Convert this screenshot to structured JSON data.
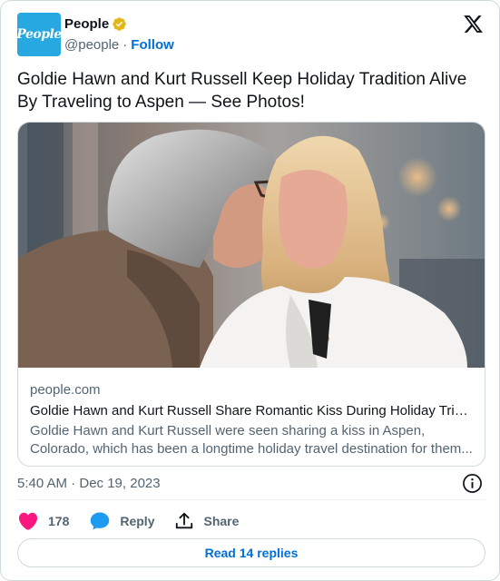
{
  "account": {
    "name": "People",
    "handle": "@people",
    "separator": "·",
    "follow_label": "Follow",
    "avatar_text": "People"
  },
  "tweet": {
    "text": "Goldie Hawn and Kurt Russell Keep Holiday Tradition Alive By Traveling to Aspen — See Photos!",
    "timestamp": "5:40 AM · Dec 19, 2023"
  },
  "card": {
    "domain": "people.com",
    "title": "Goldie Hawn and Kurt Russell Share Romantic Kiss During Holiday Trip i...",
    "description": "Goldie Hawn and Kurt Russell were seen sharing a kiss in Aspen, Colorado, which has been a longtime holiday travel destination for them..."
  },
  "actions": {
    "like_count": "178",
    "reply_label": "Reply",
    "share_label": "Share",
    "read_replies_label": "Read 14 replies"
  },
  "colors": {
    "accent_blue": "#006fd6",
    "like_red": "#f91880",
    "reply_blue": "#1d9bf0",
    "verified_gold": "#e2b719",
    "avatar_blue": "#27a8e0"
  }
}
